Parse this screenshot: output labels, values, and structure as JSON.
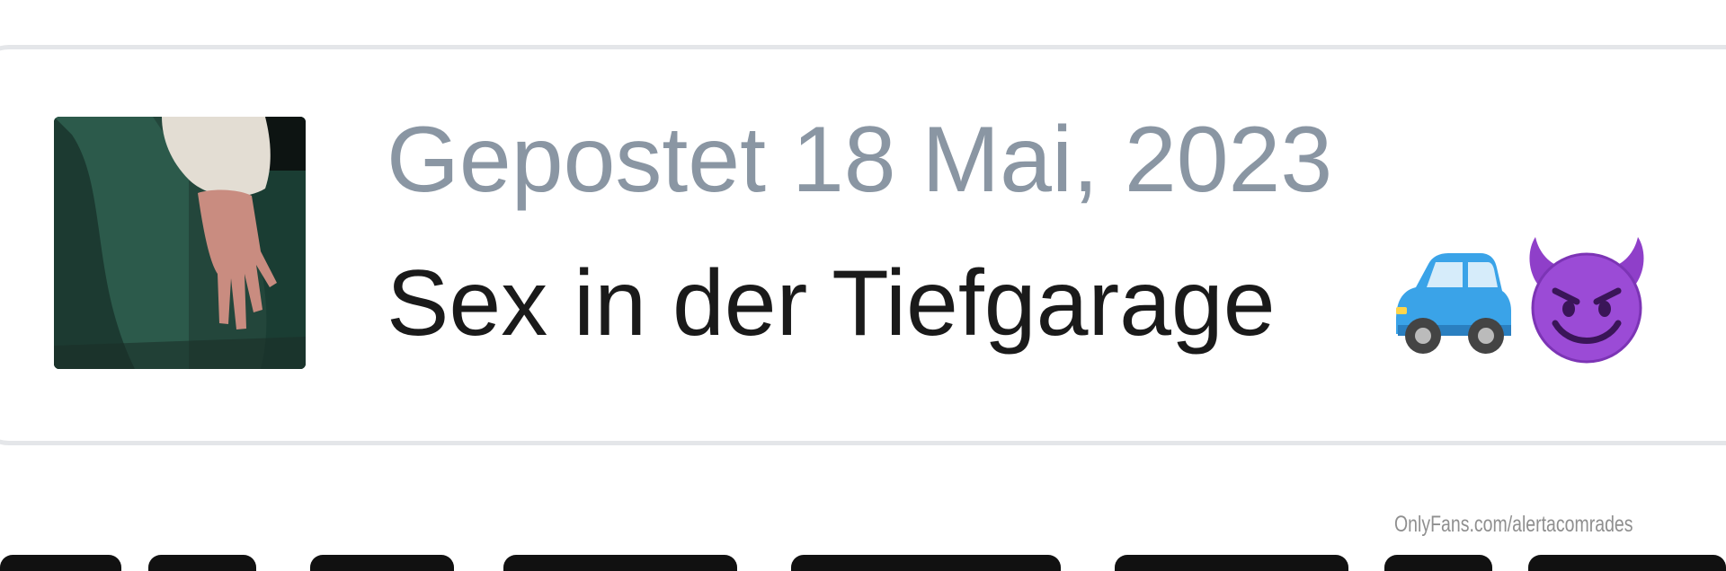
{
  "post": {
    "date_text": "Gepostet 18 Mai, 2023",
    "title_text": "Sex in der Tiefgarage",
    "emojis": [
      "car-icon",
      "smiling-devil-icon"
    ],
    "thumbnail": "post-thumbnail-image"
  },
  "watermark": "OnlyFans.com/alertacomrades",
  "colors": {
    "date": "#8a96a3",
    "title": "#1a1a1a",
    "card_border": "#e4e6e9",
    "watermark": "#8f8f8f"
  }
}
